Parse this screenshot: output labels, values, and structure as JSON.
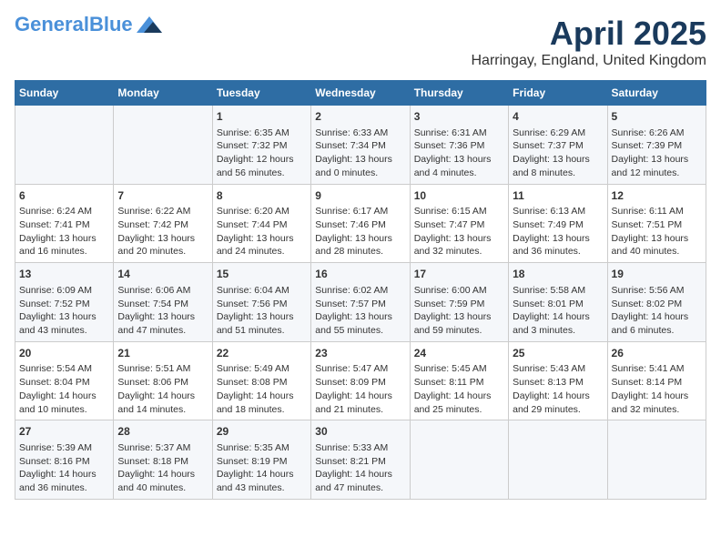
{
  "header": {
    "logo_general": "General",
    "logo_blue": "Blue",
    "title": "April 2025",
    "subtitle": "Harringay, England, United Kingdom"
  },
  "days_of_week": [
    "Sunday",
    "Monday",
    "Tuesday",
    "Wednesday",
    "Thursday",
    "Friday",
    "Saturday"
  ],
  "weeks": [
    [
      {
        "day": "",
        "info": ""
      },
      {
        "day": "",
        "info": ""
      },
      {
        "day": "1",
        "info": "Sunrise: 6:35 AM\nSunset: 7:32 PM\nDaylight: 12 hours and 56 minutes."
      },
      {
        "day": "2",
        "info": "Sunrise: 6:33 AM\nSunset: 7:34 PM\nDaylight: 13 hours and 0 minutes."
      },
      {
        "day": "3",
        "info": "Sunrise: 6:31 AM\nSunset: 7:36 PM\nDaylight: 13 hours and 4 minutes."
      },
      {
        "day": "4",
        "info": "Sunrise: 6:29 AM\nSunset: 7:37 PM\nDaylight: 13 hours and 8 minutes."
      },
      {
        "day": "5",
        "info": "Sunrise: 6:26 AM\nSunset: 7:39 PM\nDaylight: 13 hours and 12 minutes."
      }
    ],
    [
      {
        "day": "6",
        "info": "Sunrise: 6:24 AM\nSunset: 7:41 PM\nDaylight: 13 hours and 16 minutes."
      },
      {
        "day": "7",
        "info": "Sunrise: 6:22 AM\nSunset: 7:42 PM\nDaylight: 13 hours and 20 minutes."
      },
      {
        "day": "8",
        "info": "Sunrise: 6:20 AM\nSunset: 7:44 PM\nDaylight: 13 hours and 24 minutes."
      },
      {
        "day": "9",
        "info": "Sunrise: 6:17 AM\nSunset: 7:46 PM\nDaylight: 13 hours and 28 minutes."
      },
      {
        "day": "10",
        "info": "Sunrise: 6:15 AM\nSunset: 7:47 PM\nDaylight: 13 hours and 32 minutes."
      },
      {
        "day": "11",
        "info": "Sunrise: 6:13 AM\nSunset: 7:49 PM\nDaylight: 13 hours and 36 minutes."
      },
      {
        "day": "12",
        "info": "Sunrise: 6:11 AM\nSunset: 7:51 PM\nDaylight: 13 hours and 40 minutes."
      }
    ],
    [
      {
        "day": "13",
        "info": "Sunrise: 6:09 AM\nSunset: 7:52 PM\nDaylight: 13 hours and 43 minutes."
      },
      {
        "day": "14",
        "info": "Sunrise: 6:06 AM\nSunset: 7:54 PM\nDaylight: 13 hours and 47 minutes."
      },
      {
        "day": "15",
        "info": "Sunrise: 6:04 AM\nSunset: 7:56 PM\nDaylight: 13 hours and 51 minutes."
      },
      {
        "day": "16",
        "info": "Sunrise: 6:02 AM\nSunset: 7:57 PM\nDaylight: 13 hours and 55 minutes."
      },
      {
        "day": "17",
        "info": "Sunrise: 6:00 AM\nSunset: 7:59 PM\nDaylight: 13 hours and 59 minutes."
      },
      {
        "day": "18",
        "info": "Sunrise: 5:58 AM\nSunset: 8:01 PM\nDaylight: 14 hours and 3 minutes."
      },
      {
        "day": "19",
        "info": "Sunrise: 5:56 AM\nSunset: 8:02 PM\nDaylight: 14 hours and 6 minutes."
      }
    ],
    [
      {
        "day": "20",
        "info": "Sunrise: 5:54 AM\nSunset: 8:04 PM\nDaylight: 14 hours and 10 minutes."
      },
      {
        "day": "21",
        "info": "Sunrise: 5:51 AM\nSunset: 8:06 PM\nDaylight: 14 hours and 14 minutes."
      },
      {
        "day": "22",
        "info": "Sunrise: 5:49 AM\nSunset: 8:08 PM\nDaylight: 14 hours and 18 minutes."
      },
      {
        "day": "23",
        "info": "Sunrise: 5:47 AM\nSunset: 8:09 PM\nDaylight: 14 hours and 21 minutes."
      },
      {
        "day": "24",
        "info": "Sunrise: 5:45 AM\nSunset: 8:11 PM\nDaylight: 14 hours and 25 minutes."
      },
      {
        "day": "25",
        "info": "Sunrise: 5:43 AM\nSunset: 8:13 PM\nDaylight: 14 hours and 29 minutes."
      },
      {
        "day": "26",
        "info": "Sunrise: 5:41 AM\nSunset: 8:14 PM\nDaylight: 14 hours and 32 minutes."
      }
    ],
    [
      {
        "day": "27",
        "info": "Sunrise: 5:39 AM\nSunset: 8:16 PM\nDaylight: 14 hours and 36 minutes."
      },
      {
        "day": "28",
        "info": "Sunrise: 5:37 AM\nSunset: 8:18 PM\nDaylight: 14 hours and 40 minutes."
      },
      {
        "day": "29",
        "info": "Sunrise: 5:35 AM\nSunset: 8:19 PM\nDaylight: 14 hours and 43 minutes."
      },
      {
        "day": "30",
        "info": "Sunrise: 5:33 AM\nSunset: 8:21 PM\nDaylight: 14 hours and 47 minutes."
      },
      {
        "day": "",
        "info": ""
      },
      {
        "day": "",
        "info": ""
      },
      {
        "day": "",
        "info": ""
      }
    ]
  ]
}
